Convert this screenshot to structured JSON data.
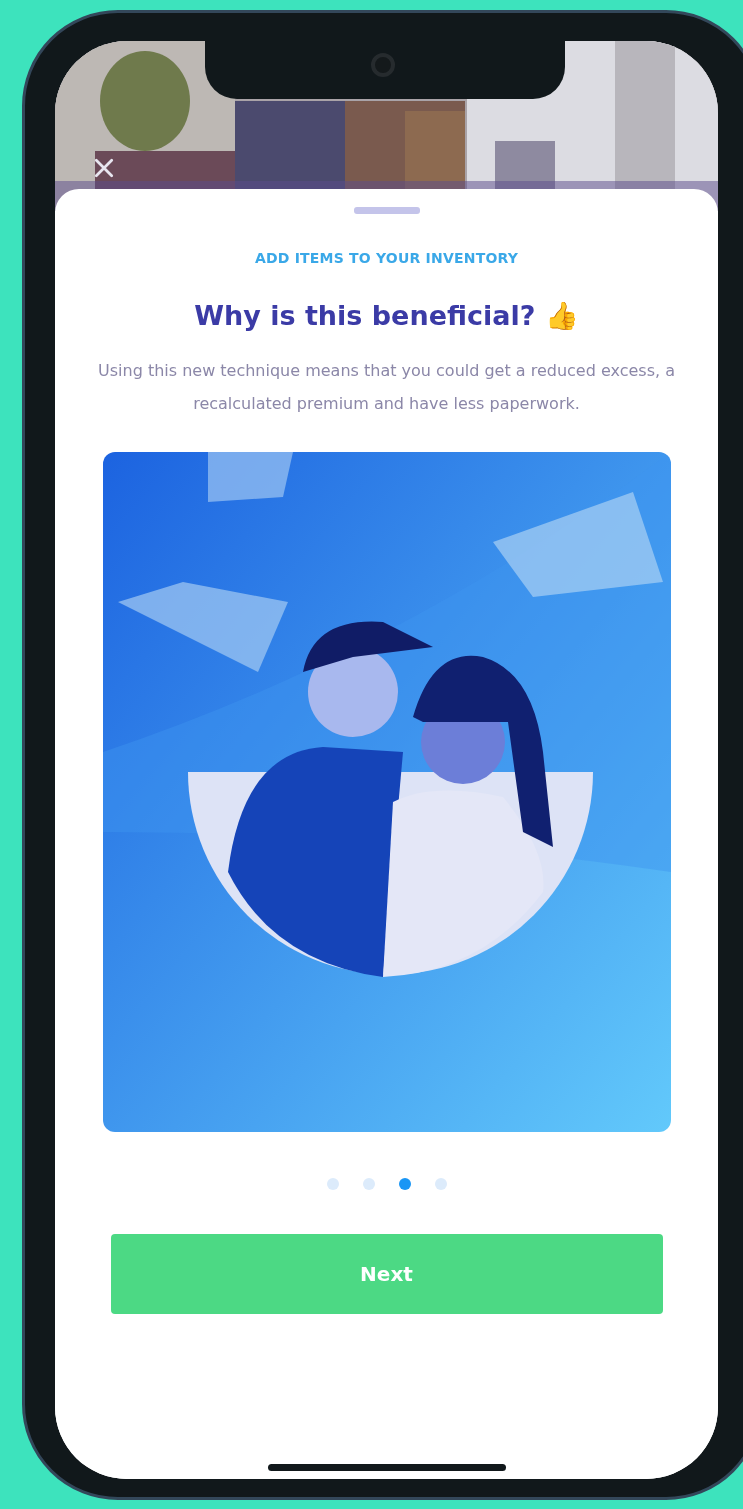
{
  "sheet": {
    "eyebrow": "ADD ITEMS TO YOUR INVENTORY",
    "title": "Why is this beneficial? 👍",
    "body": "Using this new technique means that you could get a reduced excess, a recalculated premium and have less paperwork."
  },
  "pager": [
    {
      "selected": false
    },
    {
      "selected": false
    },
    {
      "selected": true
    },
    {
      "selected": false
    }
  ],
  "buttons": [
    "Next"
  ]
}
